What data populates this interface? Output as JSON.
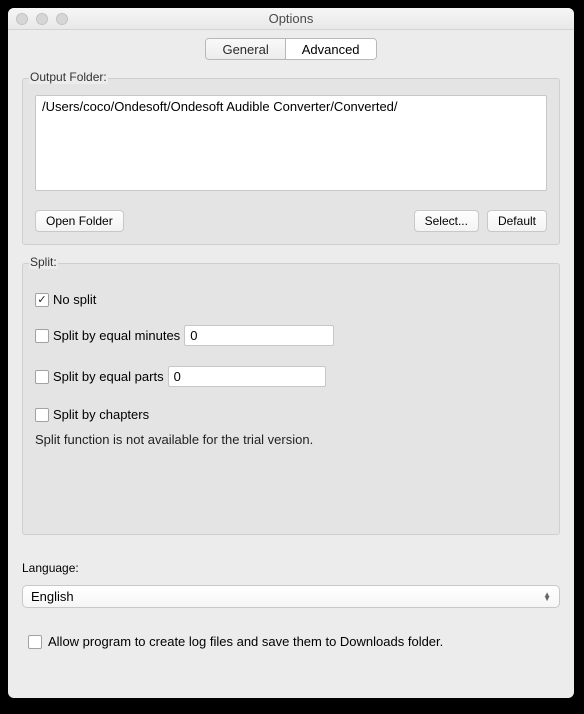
{
  "window_title": "Options",
  "tabs": {
    "general": "General",
    "advanced": "Advanced"
  },
  "output_folder": {
    "label": "Output Folder:",
    "path": "/Users/coco/Ondesoft/Ondesoft Audible Converter/Converted/",
    "open_btn": "Open Folder",
    "select_btn": "Select...",
    "default_btn": "Default"
  },
  "split": {
    "label": "Split:",
    "no_split": "No split",
    "equal_minutes": "Split by equal minutes",
    "equal_minutes_value": "0",
    "equal_parts": "Split by equal parts",
    "equal_parts_value": "0",
    "by_chapters": "Split by chapters",
    "trial_note": "Split function is not available for the trial version."
  },
  "language": {
    "label": "Language:",
    "selected": "English"
  },
  "log_option": "Allow program to create log files and save them to Downloads folder."
}
